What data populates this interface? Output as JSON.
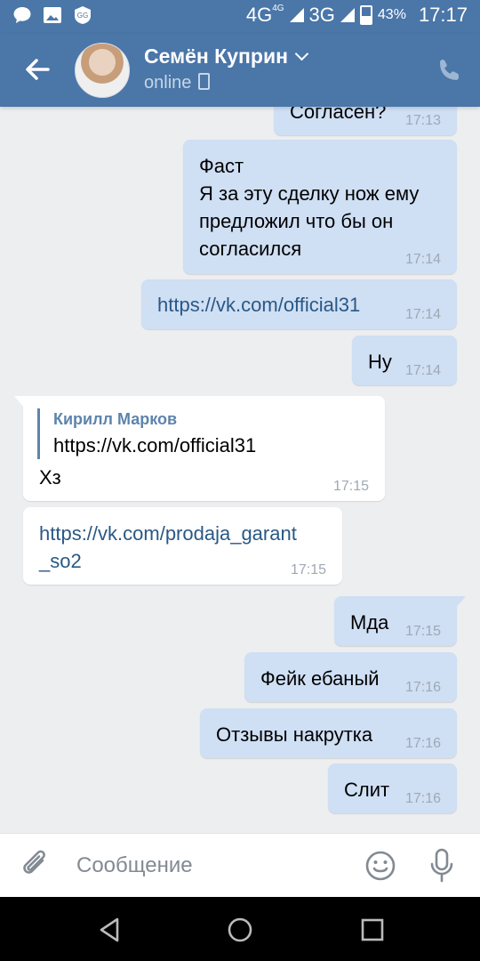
{
  "status_bar": {
    "network": "4G",
    "network_sup": "4G",
    "network2": "3G",
    "battery": "43%",
    "time": "17:17"
  },
  "header": {
    "name": "Семён Куприн",
    "status": "online"
  },
  "messages": [
    {
      "text": "Согласен?",
      "time": "17:13"
    },
    {
      "lines": [
        "Фаст",
        "Я за эту сделку нож ему",
        "предложил что бы он",
        "согласился"
      ],
      "time": "17:14"
    },
    {
      "text": "https://vk.com/official31",
      "time": "17:14"
    },
    {
      "text": "Ну",
      "time": "17:14"
    },
    {
      "quote_author": "Кирилл Марков",
      "quote_text": "https://vk.com/official31",
      "text": "Хз",
      "time": "17:15"
    },
    {
      "lines": [
        "https://vk.com/prodaja_garant",
        "_so2"
      ],
      "time": "17:15"
    },
    {
      "text": "Мда",
      "time": "17:15"
    },
    {
      "text": "Фейк ебаный",
      "time": "17:16"
    },
    {
      "text": "Отзывы накрутка",
      "time": "17:16"
    },
    {
      "text": "Слит",
      "time": "17:16"
    }
  ],
  "input": {
    "placeholder": "Сообщение"
  },
  "icons": [
    "chat-icon",
    "image-icon",
    "app-badge-icon",
    "back-arrow-icon",
    "chevron-down-icon",
    "phone-icon",
    "call-icon",
    "attach-icon",
    "smile-icon",
    "mic-icon",
    "nav-back-icon",
    "nav-home-icon",
    "nav-recents-icon"
  ],
  "colors": {
    "accent": "#4a76a8",
    "outgoing_bubble": "#cfdff4",
    "incoming_bubble": "#ffffff",
    "link": "#2a5885",
    "background": "#edeef0"
  }
}
